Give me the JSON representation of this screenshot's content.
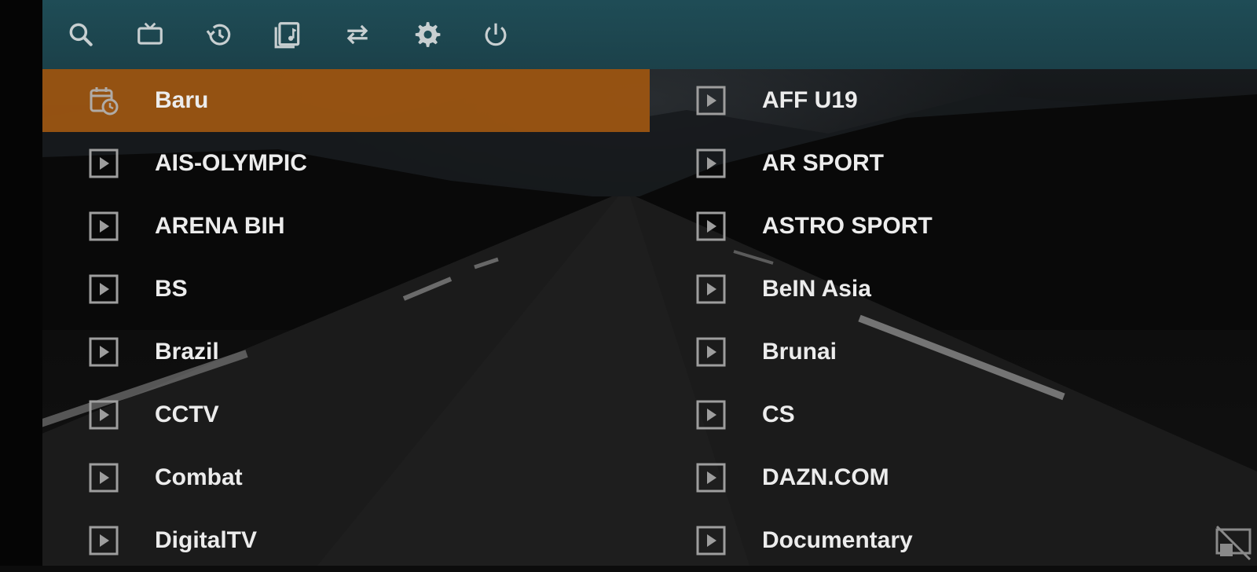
{
  "toolbar": {
    "icons": [
      "search-icon",
      "tv-icon",
      "history-icon",
      "media-library-icon",
      "swap-icon",
      "settings-icon",
      "power-icon"
    ]
  },
  "colors": {
    "toolbar_bg": "#1f4e58",
    "selected_bg": "#9a5412",
    "text": "#ececec",
    "icon": "#9e9e9e"
  },
  "categories": {
    "left": [
      {
        "label": "Baru",
        "icon": "calendar-clock-icon",
        "selected": true
      },
      {
        "label": "AIS-OLYMPIC",
        "icon": "play-icon"
      },
      {
        "label": "ARENA BIH",
        "icon": "play-icon"
      },
      {
        "label": "BS",
        "icon": "play-icon"
      },
      {
        "label": "Brazil",
        "icon": "play-icon"
      },
      {
        "label": "CCTV",
        "icon": "play-icon"
      },
      {
        "label": "Combat",
        "icon": "play-icon"
      },
      {
        "label": "DigitalTV",
        "icon": "play-icon"
      }
    ],
    "right": [
      {
        "label": "AFF U19",
        "icon": "play-icon"
      },
      {
        "label": "AR SPORT",
        "icon": "play-icon"
      },
      {
        "label": "ASTRO SPORT",
        "icon": "play-icon"
      },
      {
        "label": "BeIN Asia",
        "icon": "play-icon"
      },
      {
        "label": "Brunai",
        "icon": "play-icon"
      },
      {
        "label": "CS",
        "icon": "play-icon"
      },
      {
        "label": "DAZN.COM",
        "icon": "play-icon"
      },
      {
        "label": "Documentary",
        "icon": "play-icon"
      }
    ]
  },
  "corner_icon": "picture-in-picture-off-icon"
}
